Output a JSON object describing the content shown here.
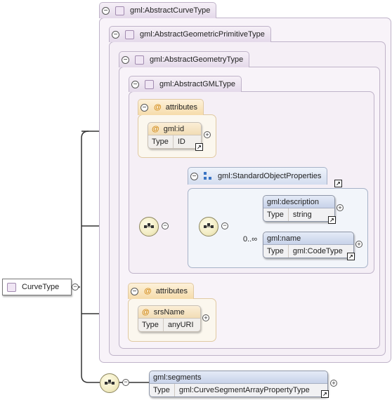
{
  "root": {
    "label": "CurveType"
  },
  "base_types": [
    {
      "label": "gml:AbstractCurveType"
    },
    {
      "label": "gml:AbstractGeometricPrimitiveType"
    },
    {
      "label": "gml:AbstractGeometryType"
    },
    {
      "label": "gml:AbstractGMLType"
    }
  ],
  "attribute_groups": [
    {
      "label": "attributes",
      "attribute": {
        "name": "gml:id",
        "type_label": "Type",
        "type": "ID"
      }
    },
    {
      "label": "attributes",
      "attribute": {
        "name": "srsName",
        "type_label": "Type",
        "type": "anyURI"
      }
    }
  ],
  "group": {
    "label": "gml:StandardObjectProperties",
    "elements": [
      {
        "name": "gml:description",
        "type_label": "Type",
        "type": "string",
        "occurrence": ""
      },
      {
        "name": "gml:name",
        "type_label": "Type",
        "type": "gml:CodeType",
        "occurrence": "0..∞"
      }
    ]
  },
  "segments": {
    "name": "gml:segments",
    "type_label": "Type",
    "type": "gml:CurveSegmentArrayPropertyType"
  },
  "icons": {
    "collapse": "minus-circle-icon",
    "expand": "plus-circle-icon",
    "link": "link-arrow-icon",
    "sequence": "sequence-icon",
    "type": "complex-type-icon",
    "attribute": "attribute-at-icon",
    "group": "group-icon"
  },
  "colors": {
    "type_tab": "#e4d9ea",
    "attribute_tab": "#f6dcab",
    "element_head": "#c7d2e9",
    "sequence": "#f2ecc4"
  }
}
